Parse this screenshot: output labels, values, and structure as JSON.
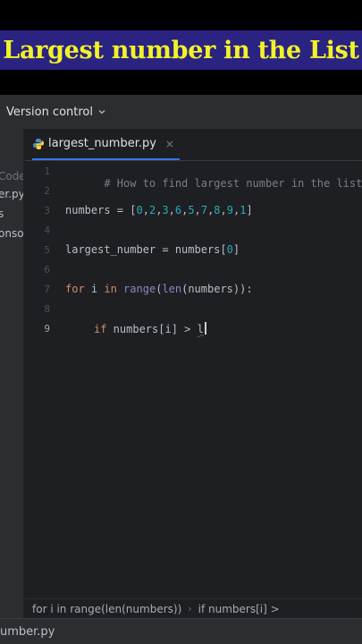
{
  "banner": {
    "title": "Largest number in the List"
  },
  "topbar": {
    "version_control": "Version control"
  },
  "project_panel": {
    "items": [
      "Code",
      "er.py",
      "s",
      "onso"
    ]
  },
  "tab": {
    "filename": "largest_number.py",
    "close": "×"
  },
  "editor": {
    "line_numbers": [
      "1",
      "2",
      "3",
      "4",
      "5",
      "6",
      "7",
      "8",
      "9"
    ],
    "active_line": "9",
    "lines": {
      "l1_comment": "# How to find largest number in the list",
      "l3_name": "numbers = [",
      "l3_values": [
        "0",
        "2",
        "3",
        "6",
        "5",
        "7",
        "8",
        "9",
        "1"
      ],
      "l3_sep": ",",
      "l3_close": "]",
      "l5_text": "largest_number = numbers[",
      "l5_index": "0",
      "l5_close": "]",
      "l7_for": "for",
      "l7_i": " i ",
      "l7_in": "in",
      "l7_range": " range",
      "l7_paren1": "(",
      "l7_len": "len",
      "l7_rest": "(numbers)):",
      "l9_if": "if",
      "l9_rest": " numbers[i] > ",
      "l9_typed": "l"
    }
  },
  "breadcrumbs": {
    "first": "for i in range(len(numbers))",
    "separator": "›",
    "second": "if numbers[i] >"
  },
  "bottombar": {
    "file": "umber.py"
  },
  "colors": {
    "accent": "#3574f0",
    "banner_bg": "#2a2382",
    "banner_text": "#f2f229"
  }
}
